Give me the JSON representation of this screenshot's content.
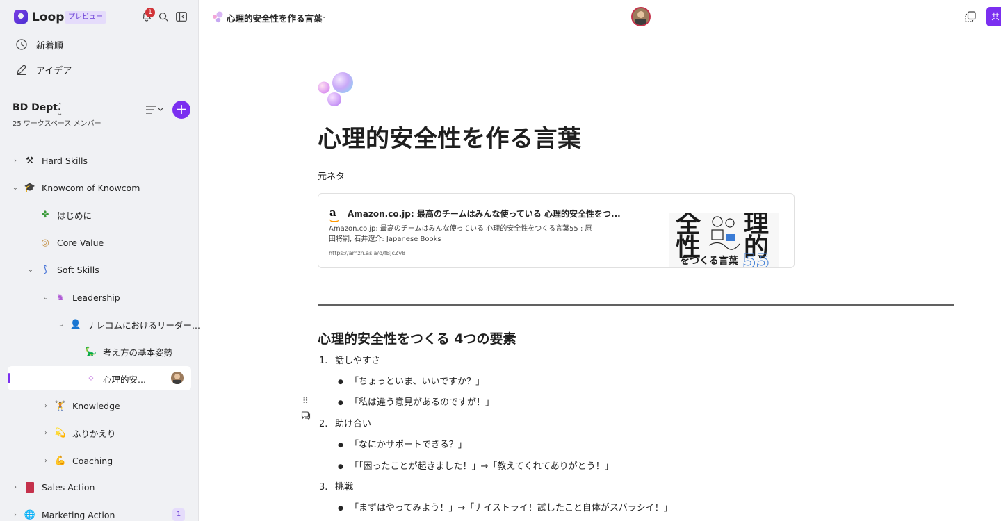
{
  "app": {
    "name": "Loop",
    "preview_label": "プレビュー",
    "notification_count": "1"
  },
  "nav": {
    "recent_label": "新着順",
    "ideas_label": "アイデア"
  },
  "workspace": {
    "name": "BD Dept.",
    "members": "25 ワークスペース メンバー"
  },
  "tree": {
    "hard_skills": "Hard Skills",
    "knowcom": "Knowcom of Knowcom",
    "intro": "はじめに",
    "core_value": "Core Value",
    "soft_skills": "Soft Skills",
    "leadership": "Leadership",
    "narecom_leader": "ナレコムにおけるリーダー...",
    "thinking_basics": "考え方の基本姿勢",
    "psych_safety": "心理的安...",
    "knowledge": "Knowledge",
    "retrospect": "ふりかえり",
    "coaching": "Coaching",
    "sales_action": "Sales Action",
    "marketing_action": "Marketing Action",
    "marketing_count": "1"
  },
  "header": {
    "doc_title": "心理的安全性を作る言葉",
    "share_label": "共"
  },
  "doc": {
    "title": "心理的安全性を作る言葉",
    "source_label": "元ネタ",
    "card": {
      "logo_text": "a",
      "title": "Amazon.co.jp: 最高のチームはみんな使っている 心理的安全性をつ...",
      "desc": "Amazon.co.jp: 最高のチームはみんな使っている 心理的安全性をつくる言葉55 : 原田将嗣, 石井遼介: Japanese Books",
      "url": "https://amzn.asia/d/fBJcZv8",
      "thumb_chars": [
        "全",
        "性",
        "理",
        "的"
      ],
      "thumb_line": "をつくる言葉",
      "thumb_num": "55"
    },
    "section_heading": "心理的安全性をつくる 4つの要素",
    "list": [
      {
        "num": "1.",
        "label": "話しやすさ",
        "bullets": [
          "「ちょっといま、いいですか？」",
          "「私は違う意見があるのですが！」"
        ]
      },
      {
        "num": "2.",
        "label": "助け合い",
        "bullets": [
          "「なにかサポートできる？」",
          "「「困ったことが起きました！」→「教えてくれてありがとう！」"
        ]
      },
      {
        "num": "3.",
        "label": "挑戦",
        "bullets": [
          "「まずはやってみよう！」→「ナイストライ！試したこと自体がスバラシイ！」"
        ]
      }
    ]
  },
  "colors": {
    "accent": "#7b2ff0",
    "badge_red": "#d13438",
    "sidebar_bg": "#f0f1f4"
  }
}
